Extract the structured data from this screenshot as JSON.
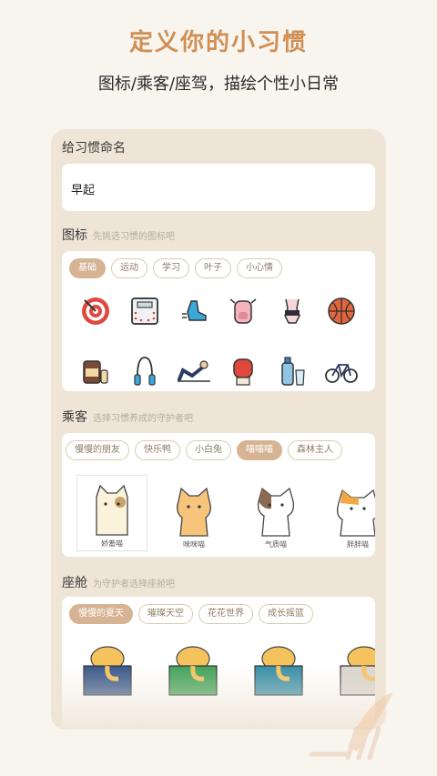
{
  "header": {
    "title": "定义你的小习惯",
    "subtitle": "图标/乘客/座驾，描绘个性小日常"
  },
  "name_section": {
    "title": "给习惯命名",
    "value": "早起"
  },
  "icon_section": {
    "title": "图标",
    "hint": "先挑选习惯的图标吧",
    "tabs": [
      "基础",
      "运动",
      "学习",
      "叶子",
      "小心情"
    ],
    "active_tab": "基础",
    "icons": [
      "target-icon",
      "scale-icon",
      "running-shoe-icon",
      "cow-icon",
      "swimsuit-icon",
      "basketball-icon",
      "protein-jar-icon",
      "jump-rope-icon",
      "situp-icon",
      "boxing-glove-icon",
      "water-bottle-icon",
      "bicycle-icon"
    ]
  },
  "passenger_section": {
    "title": "乘客",
    "hint": "选择习惯养成的守护者吧",
    "tabs": [
      "慢慢的朋友",
      "快乐鸭",
      "小白兔",
      "喵喵喵",
      "森林主人"
    ],
    "active_tab": "喵喵喵",
    "cats": [
      {
        "name": "娇羞喵",
        "colors": [
          "#fbf2dc",
          "#c8a06a"
        ]
      },
      {
        "name": "咪咪喵",
        "colors": [
          "#f6c47b",
          "#e39b4b"
        ]
      },
      {
        "name": "气质喵",
        "colors": [
          "#ffffff",
          "#8b6b50"
        ]
      },
      {
        "name": "胖胖喵",
        "colors": [
          "#ffffff",
          "#f2a944"
        ]
      }
    ]
  },
  "cabin_section": {
    "title": "座舱",
    "hint": "为守护者选择座舱吧",
    "tabs": [
      "慢慢的夏天",
      "璀璨天空",
      "花花世界",
      "成长摇篮"
    ],
    "active_tab": "慢慢的夏天",
    "pods": [
      {
        "color": "#3a5a8c"
      },
      {
        "color": "#43a35a"
      },
      {
        "color": "#3a8fa8"
      },
      {
        "color": "#d9d5cf"
      }
    ]
  },
  "colors": {
    "accent": "#d08f55",
    "chip_active": "#d6b393",
    "card": "#efe5d7"
  }
}
